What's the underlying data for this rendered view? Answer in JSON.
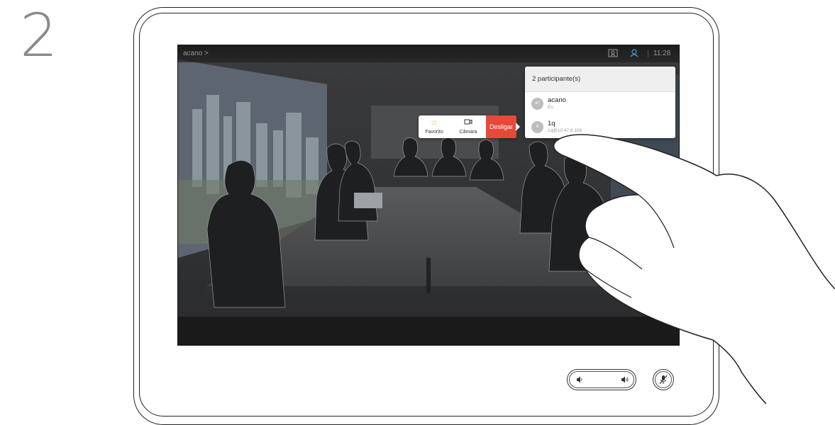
{
  "step": {
    "number": "2"
  },
  "screen": {
    "title": "acano >",
    "clock": "11:28",
    "icons": [
      "layout-icon",
      "participants-icon"
    ]
  },
  "call_actions": {
    "favorite": {
      "label": "Favorito",
      "icon": "star-icon"
    },
    "camera": {
      "label": "Câmara",
      "icon": "camera-icon"
    },
    "hangup": {
      "label": "Desligar",
      "color": "#e5493a"
    }
  },
  "participants": {
    "header": "2 participante(s)",
    "list": [
      {
        "initials": "AC",
        "name": "acano",
        "sub": "Eu"
      },
      {
        "initials": "R",
        "name": "1q",
        "sub": "1q@10.47.8.108"
      }
    ]
  },
  "controls": {
    "volume_down_icon": "volume-down-icon",
    "volume_up_icon": "volume-up-icon",
    "mute_icon": "mic-muted-icon"
  },
  "colors": {
    "accent": "#e5493a",
    "star": "#f2c033",
    "participants_icon": "#4aa3df"
  }
}
